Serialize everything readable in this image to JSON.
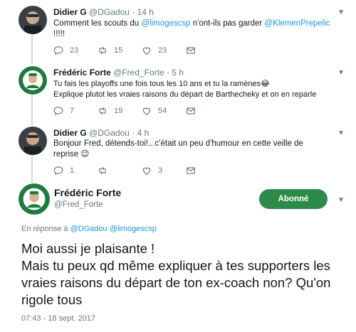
{
  "thread": [
    {
      "name": "Didier G",
      "handle": "@DGadou",
      "time": "14 h",
      "text_lines": [
        [
          {
            "t": "Comment les scouts du "
          },
          {
            "t": "@limogescsp",
            "m": true
          },
          {
            "t": " n'ont-ils pas garder "
          },
          {
            "t": "@KlemenPrepelic",
            "m": true
          }
        ],
        [
          {
            "t": "!!!!!"
          }
        ]
      ],
      "replies": "23",
      "retweets": "15",
      "likes": "23",
      "avatar": "didier-avatar"
    },
    {
      "name": "Frédéric Forte",
      "handle": "@Fred_Forte",
      "time": "5 h",
      "text_lines": [
        [
          {
            "t": "Tu fais les playoffs une fois tous les 10 ans et tu la ramènes😂"
          }
        ],
        [
          {
            "t": "Explique plutot les vraies raisons du départ de Barthecheky et on en reparle"
          }
        ]
      ],
      "replies": "7",
      "retweets": "19",
      "likes": "54",
      "avatar": "csp-avatar"
    },
    {
      "name": "Didier G",
      "handle": "@DGadou",
      "time": "4 h",
      "text_lines": [
        [
          {
            "t": "Bonjour Fred, détends-toi!...c'était un peu d'humour en cette veille de"
          }
        ],
        [
          {
            "t": "reprise 😉"
          }
        ]
      ],
      "replies": "1",
      "retweets": "",
      "likes": "3",
      "avatar": "didier-avatar"
    }
  ],
  "main": {
    "name": "Frédéric Forte",
    "handle": "@Fred_Forte",
    "follow_label": "Abonné",
    "reply_prefix": "En réponse à ",
    "reply_mentions": "@DGadou @limogescsp",
    "text": "Moi aussi je plaisante !\nMais tu peux qd même expliquer à tes supporters les vraies raisons du départ de ton ex-coach non? Qu'on rigole tous",
    "timestamp": "07:43 - 18 sept. 2017"
  },
  "colors": {
    "mention": "#1b95e0",
    "follow_button": "#2d8b4a",
    "muted": "#657786",
    "thread_line": "#ccd6dd"
  },
  "icons": {
    "reply": "reply-icon",
    "retweet": "retweet-icon",
    "like": "heart-icon",
    "dm": "envelope-icon",
    "more": "chevron-down-icon"
  }
}
